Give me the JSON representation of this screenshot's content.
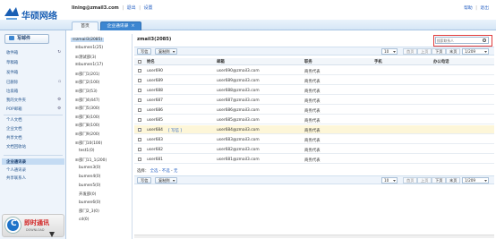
{
  "header": {
    "brand": "华硕网络",
    "user_email": "lining@zmail3.com",
    "logout": "退出",
    "settings": "设置",
    "right_links": [
      "帮助",
      "退出"
    ]
  },
  "tabs": [
    {
      "label": "首页"
    },
    {
      "label": "企业通讯录",
      "close": "×"
    }
  ],
  "sidebar": {
    "compose": "写邮件",
    "items": [
      {
        "label": "收件箱"
      },
      {
        "label": "草稿箱"
      },
      {
        "label": "发件箱"
      },
      {
        "label": "已删除"
      },
      {
        "label": "垃圾箱"
      },
      {
        "label": "我的文件夹"
      },
      {
        "label": "POP邮箱"
      },
      {
        "label": "个人文档"
      },
      {
        "label": "企业文档"
      },
      {
        "label": "共享文档"
      },
      {
        "label": "文档回收站"
      },
      {
        "label": "企业通讯录"
      },
      {
        "label": "个人通讯录"
      },
      {
        "label": "共享联系人"
      }
    ],
    "promo": {
      "title": "即时通讯",
      "sub": "DOWNLOAD"
    }
  },
  "tree": {
    "root": "zmail3(2085)",
    "items": [
      {
        "toggle": "⊞",
        "label": "bumen1(25)"
      },
      {
        "toggle": "⊞",
        "label": "测试部(3)"
      },
      {
        "toggle": "⊞",
        "label": "bumen1(17)"
      },
      {
        "toggle": "⊞",
        "label": "部门1(201)"
      },
      {
        "toggle": "⊞",
        "label": "部门2(100)"
      },
      {
        "toggle": "⊞",
        "label": "部门3(53)"
      },
      {
        "toggle": "⊞",
        "label": "部门4(447)"
      },
      {
        "toggle": "⊞",
        "label": "部门5(300)"
      },
      {
        "toggle": "⊞",
        "label": "部门6(100)"
      },
      {
        "toggle": "⊞",
        "label": "部门8(100)"
      },
      {
        "toggle": "⊞",
        "label": "部门9(200)"
      },
      {
        "toggle": "⊞",
        "label": "部门10(100)"
      },
      {
        "toggle": "",
        "label": "test1(0)"
      },
      {
        "toggle": "⊞",
        "label": "部门11_1(200)"
      },
      {
        "toggle": "",
        "label": "bumen3(0)"
      },
      {
        "toggle": "",
        "label": "bumen4(0)"
      },
      {
        "toggle": "",
        "label": "bumen5(0)"
      },
      {
        "toggle": "",
        "label": "开发部(0)"
      },
      {
        "toggle": "",
        "label": "bumen6(0)"
      },
      {
        "toggle": "",
        "label": "部门2_3(0)"
      },
      {
        "toggle": "",
        "label": "cd(0)"
      }
    ]
  },
  "main": {
    "title": "zmail3(2085)",
    "search_placeholder": "搜索联系人",
    "toolbar": {
      "write": "写信",
      "copy": "复制到",
      "page_size": "10",
      "first": "首页",
      "prev": "上页",
      "next": "下页",
      "last": "末页",
      "page": "1/209"
    },
    "columns": [
      "姓名",
      "邮箱",
      "职务",
      "手机",
      "办公电话"
    ],
    "rows": [
      {
        "name": "user690",
        "email": "user690@zmail3.com",
        "title": "商务代表",
        "mobile": "",
        "phone": "",
        "tag": ""
      },
      {
        "name": "user689",
        "email": "user689@zmail3.com",
        "title": "商务代表",
        "mobile": "",
        "phone": "",
        "tag": ""
      },
      {
        "name": "user688",
        "email": "user688@zmail3.com",
        "title": "商务代表",
        "mobile": "",
        "phone": "",
        "tag": ""
      },
      {
        "name": "user687",
        "email": "user687@zmail3.com",
        "title": "商务代表",
        "mobile": "",
        "phone": "",
        "tag": ""
      },
      {
        "name": "user686",
        "email": "user686@zmail3.com",
        "title": "商务代表",
        "mobile": "",
        "phone": "",
        "tag": ""
      },
      {
        "name": "user685",
        "email": "user685@zmail3.com",
        "title": "商务代表",
        "mobile": "",
        "phone": "",
        "tag": ""
      },
      {
        "name": "user684",
        "email": "user684@zmail3.com",
        "title": "商务代表",
        "mobile": "",
        "phone": "",
        "tag": "[ 写信 ]"
      },
      {
        "name": "user683",
        "email": "user683@zmail3.com",
        "title": "商务代表",
        "mobile": "",
        "phone": "",
        "tag": ""
      },
      {
        "name": "user682",
        "email": "user682@zmail3.com",
        "title": "商务代表",
        "mobile": "",
        "phone": "",
        "tag": ""
      },
      {
        "name": "user681",
        "email": "user681@zmail3.com",
        "title": "商务代表",
        "mobile": "",
        "phone": "",
        "tag": ""
      }
    ],
    "select_line": {
      "label": "选择：",
      "all": "全选",
      "none": "不选",
      "sep": "-",
      "none2": "无"
    }
  },
  "colors": {
    "accent": "#3c86d1",
    "brand": "#1a5fb4",
    "highlight_row": "#fdf6d8",
    "search_outline": "#e03b3b"
  }
}
